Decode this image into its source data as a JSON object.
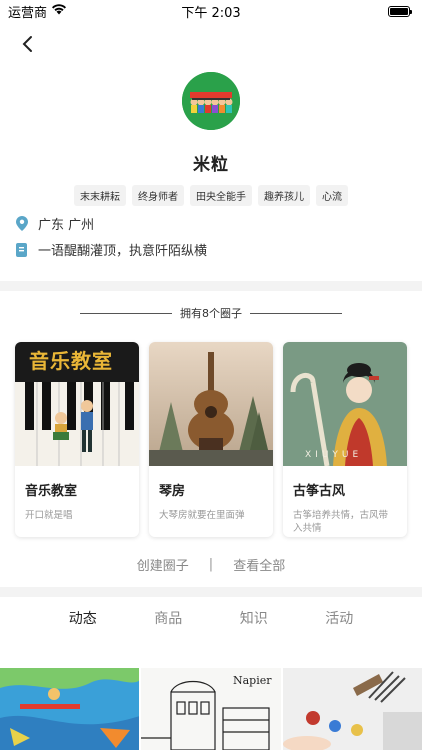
{
  "status_bar": {
    "carrier": "运营商",
    "time": "下午 2:03"
  },
  "profile": {
    "username": "米粒",
    "tags": [
      "末末耕耘",
      "终身师者",
      "田央全能手",
      "趣养孩儿",
      "心流"
    ],
    "location": "广东 广州",
    "signature": "一语醍醐灌顶，执意阡陌纵横"
  },
  "circles": {
    "title": "拥有8个圈子",
    "items": [
      {
        "name": "音乐教室",
        "desc": "开口就是唱",
        "image_text": "音乐教室"
      },
      {
        "name": "琴房",
        "desc": "大琴房就要在里面弹"
      },
      {
        "name": "古筝古风",
        "desc": "古筝培养共情，古风带入共情",
        "image_text": "XIUYUE"
      }
    ],
    "create_label": "创建圈子",
    "separator": "|",
    "view_all_label": "查看全部"
  },
  "tabs": [
    "动态",
    "商品",
    "知识",
    "活动"
  ],
  "feed": {
    "item2_text": "Napier"
  },
  "colors": {
    "accent": "#2aa14a",
    "icon_blue": "#5aa6c8"
  }
}
